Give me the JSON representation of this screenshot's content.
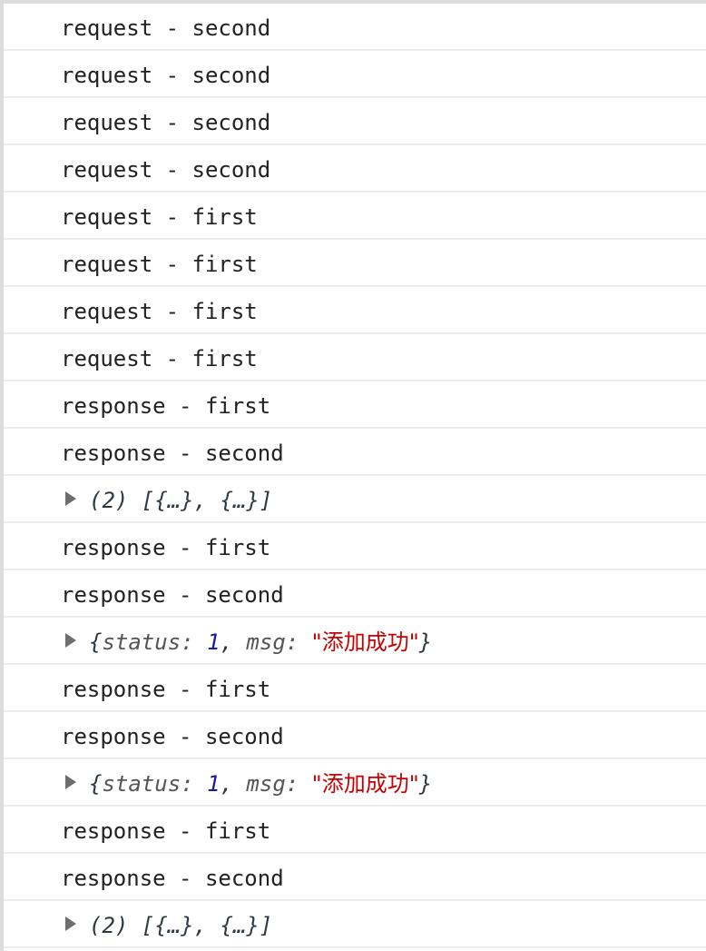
{
  "console": {
    "entries": [
      {
        "kind": "text",
        "text": "request - second"
      },
      {
        "kind": "text",
        "text": "request - second"
      },
      {
        "kind": "text",
        "text": "request - second"
      },
      {
        "kind": "text",
        "text": "request - second"
      },
      {
        "kind": "text",
        "text": "request - first"
      },
      {
        "kind": "text",
        "text": "request - first"
      },
      {
        "kind": "text",
        "text": "request - first"
      },
      {
        "kind": "text",
        "text": "request - first"
      },
      {
        "kind": "text",
        "text": "response - first"
      },
      {
        "kind": "text",
        "text": "response - second"
      },
      {
        "kind": "array",
        "preview": "(2) [{…}, {…}]"
      },
      {
        "kind": "text",
        "text": "response - first"
      },
      {
        "kind": "text",
        "text": "response - second"
      },
      {
        "kind": "object",
        "open": "{",
        "status_key": "status:",
        "status_value": "1",
        "sep": ",",
        "msg_key": "msg:",
        "msg_value": "\"添加成功\"",
        "close": "}"
      },
      {
        "kind": "text",
        "text": "response - first"
      },
      {
        "kind": "text",
        "text": "response - second"
      },
      {
        "kind": "object",
        "open": "{",
        "status_key": "status:",
        "status_value": "1",
        "sep": ",",
        "msg_key": "msg:",
        "msg_value": "\"添加成功\"",
        "close": "}"
      },
      {
        "kind": "text",
        "text": "response - first"
      },
      {
        "kind": "text",
        "text": "response - second"
      },
      {
        "kind": "array",
        "preview": "(2) [{…}, {…}]"
      }
    ]
  },
  "icons": {
    "expand": "expand-triangle-icon"
  },
  "colors": {
    "text": "#222222",
    "number": "#1a1aa6",
    "string": "#c80000",
    "row_border": "#ededed",
    "panel_border": "#dcdcdc",
    "triangle": "#6e6e6e"
  }
}
